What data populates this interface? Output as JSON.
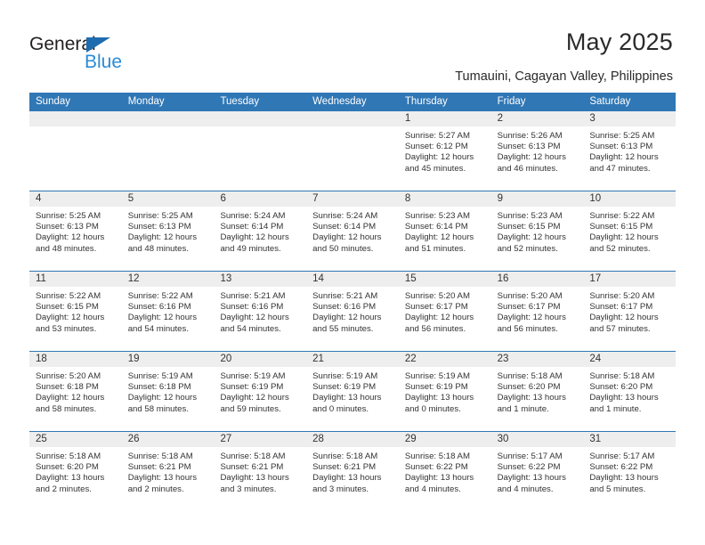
{
  "logo": {
    "word_top": "General",
    "word_bottom": "Blue",
    "triangle_color": "#1e6cb0",
    "bottom_color": "#2a8bd6"
  },
  "header": {
    "title": "May 2025",
    "subtitle": "Tumauini, Cagayan Valley, Philippines",
    "accent_color": "#3077b5",
    "band_color": "#eeeeee"
  },
  "calendar": {
    "weekday_headers": [
      "Sunday",
      "Monday",
      "Tuesday",
      "Wednesday",
      "Thursday",
      "Friday",
      "Saturday"
    ],
    "weeks": [
      [
        {
          "day": "",
          "lines": []
        },
        {
          "day": "",
          "lines": []
        },
        {
          "day": "",
          "lines": []
        },
        {
          "day": "",
          "lines": []
        },
        {
          "day": "1",
          "lines": [
            "Sunrise: 5:27 AM",
            "Sunset: 6:12 PM",
            "Daylight: 12 hours and 45 minutes."
          ]
        },
        {
          "day": "2",
          "lines": [
            "Sunrise: 5:26 AM",
            "Sunset: 6:13 PM",
            "Daylight: 12 hours and 46 minutes."
          ]
        },
        {
          "day": "3",
          "lines": [
            "Sunrise: 5:25 AM",
            "Sunset: 6:13 PM",
            "Daylight: 12 hours and 47 minutes."
          ]
        }
      ],
      [
        {
          "day": "4",
          "lines": [
            "Sunrise: 5:25 AM",
            "Sunset: 6:13 PM",
            "Daylight: 12 hours and 48 minutes."
          ]
        },
        {
          "day": "5",
          "lines": [
            "Sunrise: 5:25 AM",
            "Sunset: 6:13 PM",
            "Daylight: 12 hours and 48 minutes."
          ]
        },
        {
          "day": "6",
          "lines": [
            "Sunrise: 5:24 AM",
            "Sunset: 6:14 PM",
            "Daylight: 12 hours and 49 minutes."
          ]
        },
        {
          "day": "7",
          "lines": [
            "Sunrise: 5:24 AM",
            "Sunset: 6:14 PM",
            "Daylight: 12 hours and 50 minutes."
          ]
        },
        {
          "day": "8",
          "lines": [
            "Sunrise: 5:23 AM",
            "Sunset: 6:14 PM",
            "Daylight: 12 hours and 51 minutes."
          ]
        },
        {
          "day": "9",
          "lines": [
            "Sunrise: 5:23 AM",
            "Sunset: 6:15 PM",
            "Daylight: 12 hours and 52 minutes."
          ]
        },
        {
          "day": "10",
          "lines": [
            "Sunrise: 5:22 AM",
            "Sunset: 6:15 PM",
            "Daylight: 12 hours and 52 minutes."
          ]
        }
      ],
      [
        {
          "day": "11",
          "lines": [
            "Sunrise: 5:22 AM",
            "Sunset: 6:15 PM",
            "Daylight: 12 hours and 53 minutes."
          ]
        },
        {
          "day": "12",
          "lines": [
            "Sunrise: 5:22 AM",
            "Sunset: 6:16 PM",
            "Daylight: 12 hours and 54 minutes."
          ]
        },
        {
          "day": "13",
          "lines": [
            "Sunrise: 5:21 AM",
            "Sunset: 6:16 PM",
            "Daylight: 12 hours and 54 minutes."
          ]
        },
        {
          "day": "14",
          "lines": [
            "Sunrise: 5:21 AM",
            "Sunset: 6:16 PM",
            "Daylight: 12 hours and 55 minutes."
          ]
        },
        {
          "day": "15",
          "lines": [
            "Sunrise: 5:20 AM",
            "Sunset: 6:17 PM",
            "Daylight: 12 hours and 56 minutes."
          ]
        },
        {
          "day": "16",
          "lines": [
            "Sunrise: 5:20 AM",
            "Sunset: 6:17 PM",
            "Daylight: 12 hours and 56 minutes."
          ]
        },
        {
          "day": "17",
          "lines": [
            "Sunrise: 5:20 AM",
            "Sunset: 6:17 PM",
            "Daylight: 12 hours and 57 minutes."
          ]
        }
      ],
      [
        {
          "day": "18",
          "lines": [
            "Sunrise: 5:20 AM",
            "Sunset: 6:18 PM",
            "Daylight: 12 hours and 58 minutes."
          ]
        },
        {
          "day": "19",
          "lines": [
            "Sunrise: 5:19 AM",
            "Sunset: 6:18 PM",
            "Daylight: 12 hours and 58 minutes."
          ]
        },
        {
          "day": "20",
          "lines": [
            "Sunrise: 5:19 AM",
            "Sunset: 6:19 PM",
            "Daylight: 12 hours and 59 minutes."
          ]
        },
        {
          "day": "21",
          "lines": [
            "Sunrise: 5:19 AM",
            "Sunset: 6:19 PM",
            "Daylight: 13 hours and 0 minutes."
          ]
        },
        {
          "day": "22",
          "lines": [
            "Sunrise: 5:19 AM",
            "Sunset: 6:19 PM",
            "Daylight: 13 hours and 0 minutes."
          ]
        },
        {
          "day": "23",
          "lines": [
            "Sunrise: 5:18 AM",
            "Sunset: 6:20 PM",
            "Daylight: 13 hours and 1 minute."
          ]
        },
        {
          "day": "24",
          "lines": [
            "Sunrise: 5:18 AM",
            "Sunset: 6:20 PM",
            "Daylight: 13 hours and 1 minute."
          ]
        }
      ],
      [
        {
          "day": "25",
          "lines": [
            "Sunrise: 5:18 AM",
            "Sunset: 6:20 PM",
            "Daylight: 13 hours and 2 minutes."
          ]
        },
        {
          "day": "26",
          "lines": [
            "Sunrise: 5:18 AM",
            "Sunset: 6:21 PM",
            "Daylight: 13 hours and 2 minutes."
          ]
        },
        {
          "day": "27",
          "lines": [
            "Sunrise: 5:18 AM",
            "Sunset: 6:21 PM",
            "Daylight: 13 hours and 3 minutes."
          ]
        },
        {
          "day": "28",
          "lines": [
            "Sunrise: 5:18 AM",
            "Sunset: 6:21 PM",
            "Daylight: 13 hours and 3 minutes."
          ]
        },
        {
          "day": "29",
          "lines": [
            "Sunrise: 5:18 AM",
            "Sunset: 6:22 PM",
            "Daylight: 13 hours and 4 minutes."
          ]
        },
        {
          "day": "30",
          "lines": [
            "Sunrise: 5:17 AM",
            "Sunset: 6:22 PM",
            "Daylight: 13 hours and 4 minutes."
          ]
        },
        {
          "day": "31",
          "lines": [
            "Sunrise: 5:17 AM",
            "Sunset: 6:22 PM",
            "Daylight: 13 hours and 5 minutes."
          ]
        }
      ]
    ]
  }
}
